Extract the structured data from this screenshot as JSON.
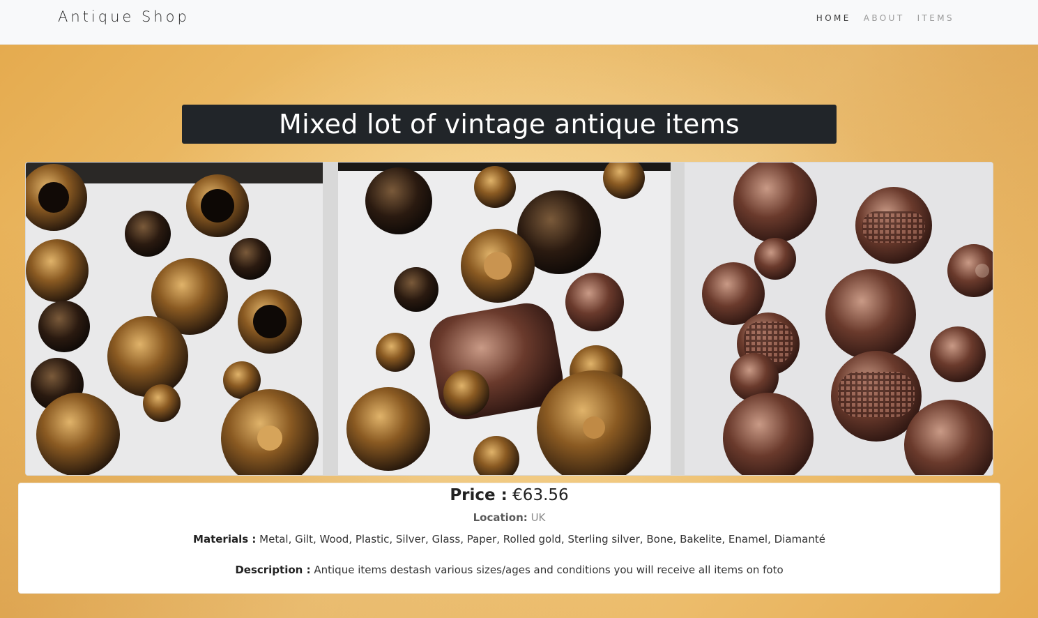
{
  "navbar": {
    "brand": "Antique Shop",
    "links": [
      {
        "label": "HOME",
        "active": true
      },
      {
        "label": "ABOUT",
        "active": false
      },
      {
        "label": "ITEMS",
        "active": false
      }
    ]
  },
  "item": {
    "title": "Mixed lot of vintage antique items",
    "price_label": "Price :",
    "price_value": "€63.56",
    "location_label": "Location:",
    "location_value": "UK",
    "materials_label": "Materials :",
    "materials_value": "Metal, Gilt, Wood, Plastic, Silver, Glass, Paper, Rolled gold, Sterling silver, Bone, Bakelite, Enamel, Diamanté",
    "description_label": "Description :",
    "description_value": "Antique items destash various sizes/ages and conditions you will receive all items on foto"
  },
  "colors": {
    "navbar_bg": "#f8f9fa",
    "title_bg": "#212529",
    "page_bg": "#f0c576"
  }
}
